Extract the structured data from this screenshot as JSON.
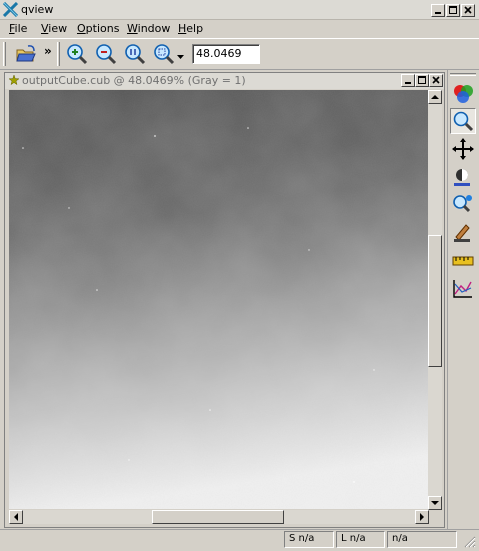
{
  "window": {
    "title": "qview"
  },
  "menubar": [
    {
      "label": "File",
      "accel": "F",
      "rest": "ile"
    },
    {
      "label": "View",
      "accel": "V",
      "rest": "iew"
    },
    {
      "label": "Options",
      "accel": "O",
      "rest": "ptions"
    },
    {
      "label": "Window",
      "accel": "W",
      "rest": "indow"
    },
    {
      "label": "Help",
      "accel": "H",
      "rest": "elp"
    }
  ],
  "toolbar": {
    "extension_glyph": "»",
    "zoom_value": "48.0469"
  },
  "child_window": {
    "title": "outputCube.cub @ 48.0469% (Gray = 1)"
  },
  "image": {
    "gray_top": "#505050",
    "gray_bottom": "#f0f0f0"
  },
  "status": {
    "sample": "S n/a",
    "line": "L n/a",
    "value": "n/a"
  },
  "colors": {
    "accent": "#dcdad4",
    "window_bg": "#d4d0c8"
  },
  "icons": [
    "qview-icon",
    "open-folder-icon",
    "zoom-in-icon",
    "zoom-out-icon",
    "zoom-actual-icon",
    "zoom-fit-icon",
    "dropdown-arrow-icon",
    "band-tool-icon",
    "zoom-tool-icon",
    "pan-tool-icon",
    "stretch-tool-icon",
    "find-tool-icon",
    "edit-tool-icon",
    "measure-tool-icon",
    "plot-tool-icon"
  ]
}
